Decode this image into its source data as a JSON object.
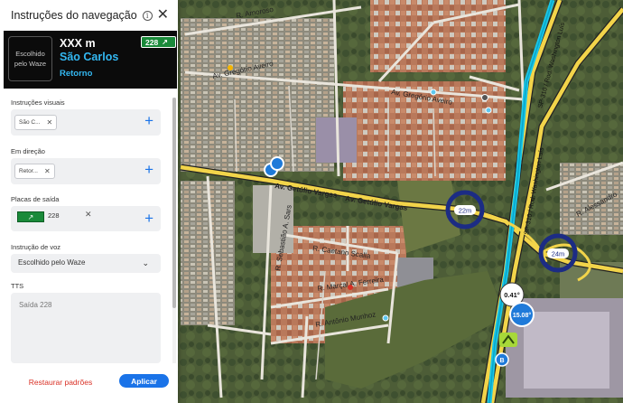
{
  "panel": {
    "title": "Instruções do navegação",
    "info_icon": "info-icon",
    "close_icon": "close-icon"
  },
  "preview": {
    "thumb_text": "Escolhido pelo Waze",
    "distance": "XXX m",
    "city": "São Carlos",
    "subtitle": "Retorno",
    "exit_badge": "228"
  },
  "sections": {
    "visual": {
      "label": "Instruções visuais",
      "chip": "São C..."
    },
    "direction": {
      "label": "Em direção",
      "chip": "Retor..."
    },
    "exit_signs": {
      "label": "Placas de saída",
      "value": "228"
    },
    "voice": {
      "label": "Instrução de voz",
      "selected": "Escolhido pelo Waze"
    },
    "tts": {
      "label": "TTS",
      "placeholder": "Saída 228"
    }
  },
  "footer": {
    "reset_label": "Restaurar padrões",
    "apply_label": "Aplicar"
  },
  "map": {
    "streets": {
      "getulio": "Av. Getúlio Vargas",
      "gregorio": "Av. Gregório Aveiro",
      "gregorio2": "Av. Gregório Aveiro",
      "caetano": "R. Caetano Scalla",
      "marcal": "R. Marçal A. Ferreira",
      "antonio": "R. Antônio Munhoz",
      "sebastiao": "R. Sebastião A. Sars",
      "amoroso": "R. Amoroso",
      "alessandro": "R. Alessandro",
      "washington": "SP-310 / Rod. Washington Luís"
    },
    "segments": {
      "seg_a": "22m",
      "seg_b": "24m",
      "speed_a": "0.41°",
      "speed_b": "15.08°",
      "marker": "B"
    }
  }
}
